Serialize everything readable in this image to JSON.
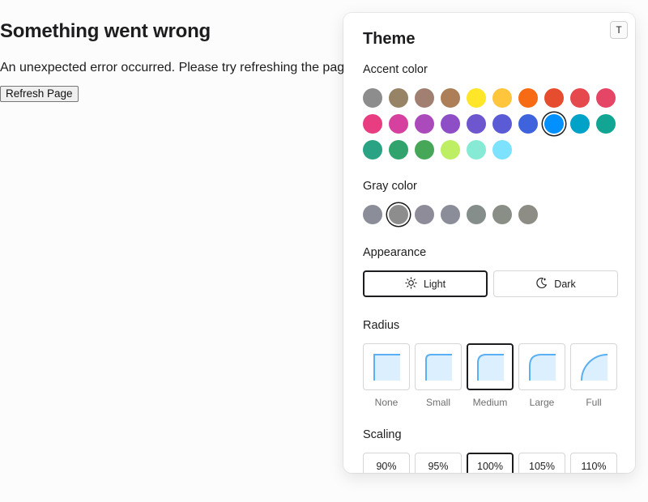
{
  "error": {
    "title": "Something went wrong",
    "message": "An unexpected error occurred. Please try refreshing the page.",
    "button_label": "Refresh Page"
  },
  "panel": {
    "title": "Theme",
    "toggle_label": "T",
    "accent": {
      "label": "Accent color",
      "selected": "blue",
      "colors": [
        {
          "name": "gray",
          "hex": "#8d8d8d"
        },
        {
          "name": "gold",
          "hex": "#978365"
        },
        {
          "name": "bronze",
          "hex": "#a18072"
        },
        {
          "name": "brown",
          "hex": "#ad7f58"
        },
        {
          "name": "yellow",
          "hex": "#ffe629"
        },
        {
          "name": "amber",
          "hex": "#ffc53d"
        },
        {
          "name": "orange",
          "hex": "#f76b15"
        },
        {
          "name": "tomato",
          "hex": "#e54d2e"
        },
        {
          "name": "red",
          "hex": "#e5484d"
        },
        {
          "name": "ruby",
          "hex": "#e54666"
        },
        {
          "name": "crimson",
          "hex": "#e93d82"
        },
        {
          "name": "pink",
          "hex": "#d6409f"
        },
        {
          "name": "plum",
          "hex": "#ab4aba"
        },
        {
          "name": "purple",
          "hex": "#8e4ec6"
        },
        {
          "name": "violet",
          "hex": "#6e56cf"
        },
        {
          "name": "iris",
          "hex": "#5b5bd6"
        },
        {
          "name": "indigo",
          "hex": "#3e63dd"
        },
        {
          "name": "blue",
          "hex": "#0090ff"
        },
        {
          "name": "cyan",
          "hex": "#00a2c7"
        },
        {
          "name": "teal",
          "hex": "#12a594"
        },
        {
          "name": "jade",
          "hex": "#29a383"
        },
        {
          "name": "green",
          "hex": "#30a46c"
        },
        {
          "name": "grass",
          "hex": "#46a758"
        },
        {
          "name": "lime",
          "hex": "#bdee63"
        },
        {
          "name": "mint",
          "hex": "#86ead4"
        },
        {
          "name": "sky",
          "hex": "#7ce2fe"
        }
      ]
    },
    "gray": {
      "label": "Gray color",
      "selected": "gray",
      "colors": [
        {
          "name": "auto",
          "hex": "#8b8d98"
        },
        {
          "name": "gray",
          "hex": "#8d8d8d"
        },
        {
          "name": "mauve",
          "hex": "#8e8c99"
        },
        {
          "name": "slate",
          "hex": "#8b8d98"
        },
        {
          "name": "sage",
          "hex": "#868e8b"
        },
        {
          "name": "olive",
          "hex": "#898e87"
        },
        {
          "name": "sand",
          "hex": "#8d8d86"
        }
      ]
    },
    "appearance": {
      "label": "Appearance",
      "options": [
        {
          "label": "Light",
          "icon": "sun-icon",
          "selected": true
        },
        {
          "label": "Dark",
          "icon": "moon-icon",
          "selected": false
        }
      ]
    },
    "radius": {
      "label": "Radius",
      "preview_fill": "#dcefff",
      "preview_stroke": "#5ab0f2",
      "options": [
        {
          "label": "None",
          "selected": false
        },
        {
          "label": "Small",
          "selected": false
        },
        {
          "label": "Medium",
          "selected": true
        },
        {
          "label": "Large",
          "selected": false
        },
        {
          "label": "Full",
          "selected": false
        }
      ]
    },
    "scaling": {
      "label": "Scaling",
      "options": [
        {
          "label": "90%",
          "selected": false
        },
        {
          "label": "95%",
          "selected": false
        },
        {
          "label": "100%",
          "selected": true
        },
        {
          "label": "105%",
          "selected": false
        },
        {
          "label": "110%",
          "selected": false
        }
      ]
    }
  }
}
